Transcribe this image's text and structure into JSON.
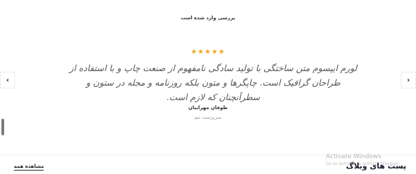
{
  "header": {
    "top_label": "بررسی وارد شده است"
  },
  "testimonial": {
    "rating": 5,
    "stars": "★★★★★",
    "quote": "لورم ایپسوم متن ساختگی با تولید سادگی نامفهوم از صنعت چاپ و با استفاده از طراحان گرافیک است. چاپگرها و متون بلکه روزنامه و مجله در ستون و سطرآنچنان که لازم است.",
    "author_name": "طوفان مهرابیان",
    "author_role": "سرپرست تیم"
  },
  "navigation": {
    "prev_icon": "‹",
    "next_icon": "›"
  },
  "footer": {
    "view_all": "مشاهده همه",
    "section_title": "پست های وبلاگ"
  },
  "watermark": {
    "line1": "Activate Windows",
    "line2": "Go to Settings to activate Windows."
  },
  "colors": {
    "star": "#f2a516",
    "text": "#333333",
    "muted": "#999999"
  }
}
